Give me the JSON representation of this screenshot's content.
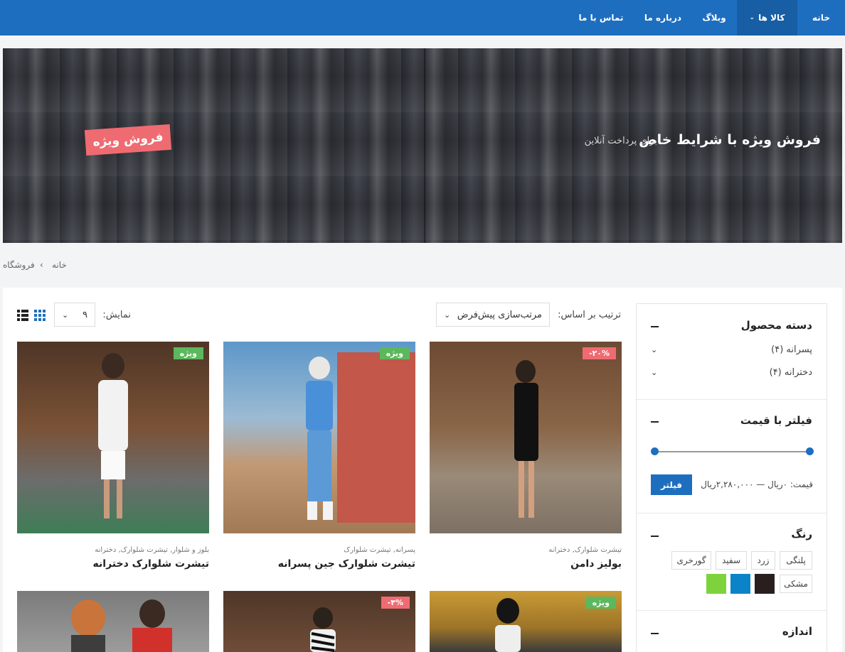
{
  "nav": {
    "home": "خانه",
    "products": "کالا ها",
    "blog": "وبلاگ",
    "about": "درباره ما",
    "contact": "تماس با ما"
  },
  "hero": {
    "title": "فروش ویژه با شرایط خاص",
    "subtitle": "برای پرداخت آنلاین",
    "badge": "فروش ویژه"
  },
  "breadcrumb": {
    "home": "خانه",
    "separator": "›",
    "current": "فروشگاه"
  },
  "toolbar": {
    "sort_label": "ترتیب بر اساس:",
    "sort_value": "مرتب‌سازی پیش‌فرض",
    "show_label": "نمایش:",
    "show_value": "۹"
  },
  "sidebar": {
    "category_title": "دسته محصول",
    "categories": [
      {
        "label": "پسرانه (۴)"
      },
      {
        "label": "دخترانه (۴)"
      }
    ],
    "price_title": "فیلتر با قیمت",
    "price_text": "قیمت: ۰ریال — ۲,۲۸۰,۰۰۰ریال",
    "filter_button": "فیلتر",
    "color_title": "رنگ",
    "color_chips": [
      "پلنگی",
      "زرد",
      "سفید",
      "گورخری",
      "مشکی"
    ],
    "swatch_colors": [
      "#2a1f1f",
      "#0a83c9",
      "#7ed33c"
    ],
    "size_title": "اندازه"
  },
  "products": [
    {
      "tag": "۲۰%-",
      "tag_color": "#ef6b72",
      "cats": "تیشرت شلوارک, دخترانه",
      "name": "بولیز دامن"
    },
    {
      "tag": "ویژه",
      "tag_color": "#5cb85c",
      "cats": "پسرانه, تیشرت شلوارک",
      "name": "تیشرت شلوارک جین پسرانه"
    },
    {
      "tag": "ویژه",
      "tag_color": "#5cb85c",
      "cats": "بلوز و شلوار, تیشرت شلوارک, دخترانه",
      "name": "تیشرت شلوارک دخترانه"
    },
    {
      "tag": "ویژه",
      "tag_color": "#5cb85c"
    },
    {
      "tag": "۴%-",
      "tag_color": "#ef6b72"
    }
  ]
}
